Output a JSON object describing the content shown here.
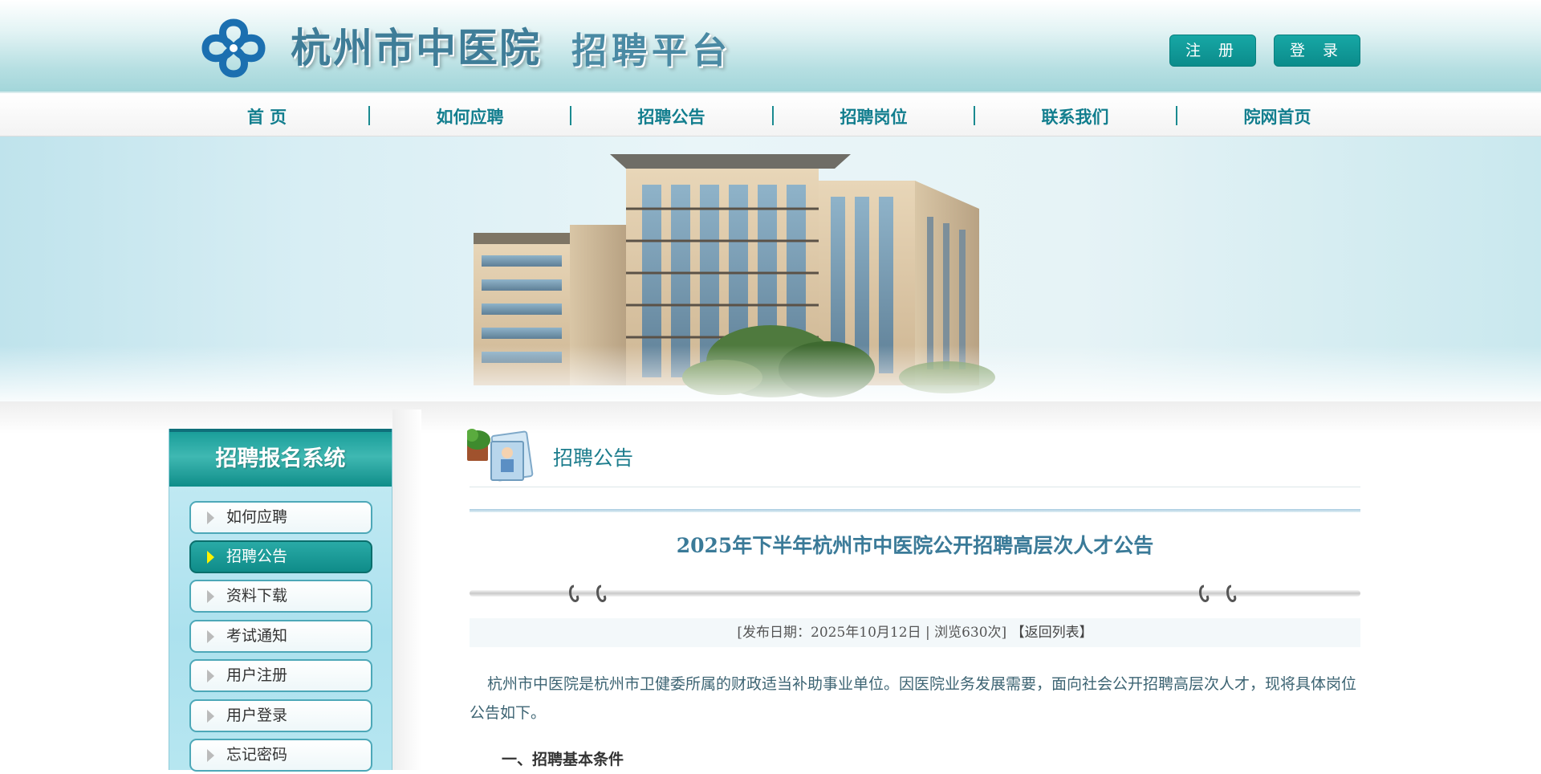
{
  "header": {
    "title": "杭州市中医院",
    "subtitle": "招聘平台",
    "register_label": "注 册",
    "login_label": "登 录"
  },
  "nav": {
    "items": [
      {
        "label": "首 页"
      },
      {
        "label": "如何应聘"
      },
      {
        "label": "招聘公告"
      },
      {
        "label": "招聘岗位"
      },
      {
        "label": "联系我们"
      },
      {
        "label": "院网首页"
      }
    ]
  },
  "sidebar": {
    "title": "招聘报名系统",
    "items": [
      {
        "label": "如何应聘",
        "active": false
      },
      {
        "label": "招聘公告",
        "active": true
      },
      {
        "label": "资料下载",
        "active": false
      },
      {
        "label": "考试通知",
        "active": false
      },
      {
        "label": "用户注册",
        "active": false
      },
      {
        "label": "用户登录",
        "active": false
      },
      {
        "label": "忘记密码",
        "active": false
      }
    ]
  },
  "main": {
    "section_title": "招聘公告",
    "article": {
      "title": "2025年下半年杭州市中医院公开招聘高层次人才公告",
      "meta": "[发布日期：2025年10月12日 | 浏览630次]",
      "back_label": "【返回列表】",
      "paragraph": "杭州市中医院是杭州市卫健委所属的财政适当补助事业单位。因医院业务发展需要，面向社会公开招聘高层次人才，现将具体岗位公告如下。",
      "heading1": "一、招聘基本条件"
    }
  },
  "colors": {
    "accent": "#0f8c89",
    "nav_text": "#127e8e",
    "title_text": "#3a7a98"
  }
}
